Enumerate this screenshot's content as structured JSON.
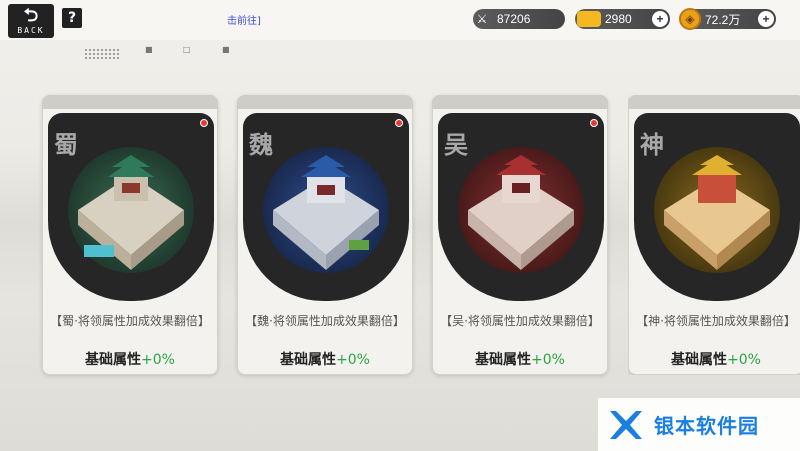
{
  "topbar": {
    "back_label": "BACK",
    "help_label": "?",
    "notice": "击前往]"
  },
  "resources": [
    {
      "icon": "crossed-swords-icon",
      "value": "87206",
      "has_plus": false
    },
    {
      "icon": "gold-ingot-icon",
      "value": "2980",
      "has_plus": true
    },
    {
      "icon": "coin-icon",
      "value": "72.2万",
      "has_plus": true
    }
  ],
  "cards": [
    {
      "faction": "蜀",
      "bonus": "【蜀·将领属性加成效果翻倍】",
      "base_label": "基础属性",
      "base_value": "+0%",
      "theme": "#3a7a5a"
    },
    {
      "faction": "魏",
      "bonus": "【魏·将领属性加成效果翻倍】",
      "base_label": "基础属性",
      "base_value": "+0%",
      "theme": "#2a4f9a"
    },
    {
      "faction": "吴",
      "bonus": "【吴·将领属性加成效果翻倍】",
      "base_label": "基础属性",
      "base_value": "+0%",
      "theme": "#a03a3a"
    },
    {
      "faction": "神",
      "bonus": "【神·将领属性加成效果翻倍】",
      "base_label": "基础属性",
      "base_value": "+0%",
      "theme": "#c09020"
    }
  ],
  "watermark": {
    "text": "银本软件园"
  },
  "colors": {
    "accent_green": "#2aa546",
    "notice_blue": "#3a4fd0",
    "badge_red": "#e23a3a"
  }
}
